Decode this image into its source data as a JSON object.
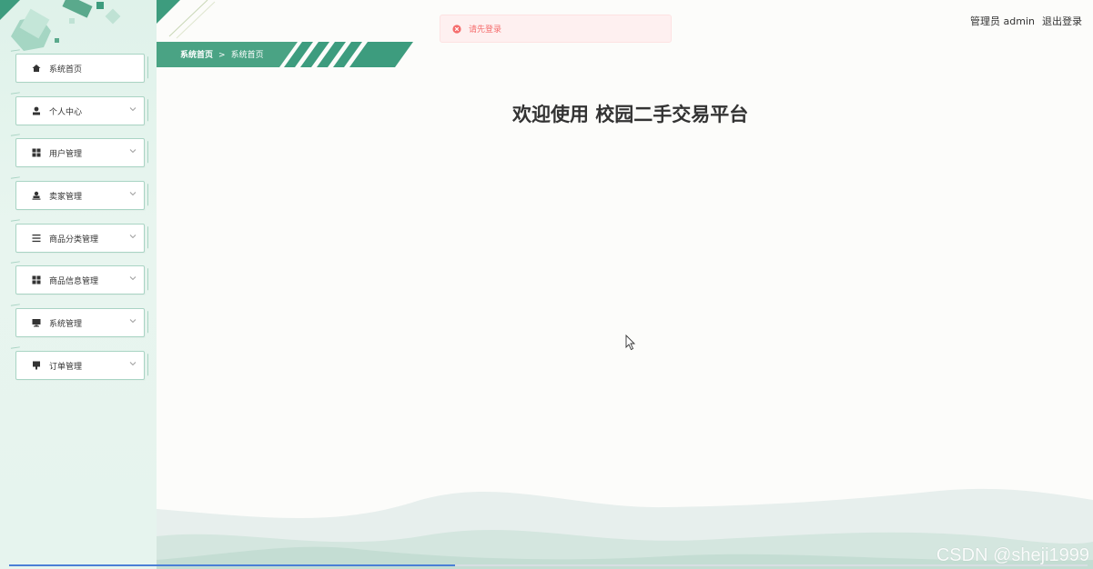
{
  "breadcrumb": {
    "home": "系统首页",
    "separator": ">",
    "current": "系统首页"
  },
  "alert": {
    "message": "请先登录",
    "icon": "error-circle-icon"
  },
  "user": {
    "role_label": "管理员",
    "username": "admin",
    "logout_label": "退出登录"
  },
  "welcome": {
    "title": "欢迎使用 校园二手交易平台"
  },
  "sidebar": {
    "items": [
      {
        "label": "系统首页",
        "icon": "home-icon",
        "has_submenu": false
      },
      {
        "label": "个人中心",
        "icon": "user-icon",
        "has_submenu": true
      },
      {
        "label": "用户管理",
        "icon": "grid-icon",
        "has_submenu": true
      },
      {
        "label": "卖家管理",
        "icon": "seller-icon",
        "has_submenu": true
      },
      {
        "label": "商品分类管理",
        "icon": "list-icon",
        "has_submenu": true
      },
      {
        "label": "商品信息管理",
        "icon": "grid-icon",
        "has_submenu": true
      },
      {
        "label": "系统管理",
        "icon": "monitor-icon",
        "has_submenu": true
      },
      {
        "label": "订单管理",
        "icon": "order-icon",
        "has_submenu": true
      }
    ]
  },
  "watermark": "CSDN @sheji1999",
  "colors": {
    "accent": "#3d9c7e",
    "sidebar_bg": "#e3f3ec",
    "alert_bg": "#fef0f0",
    "alert_text": "#f56c6c"
  }
}
